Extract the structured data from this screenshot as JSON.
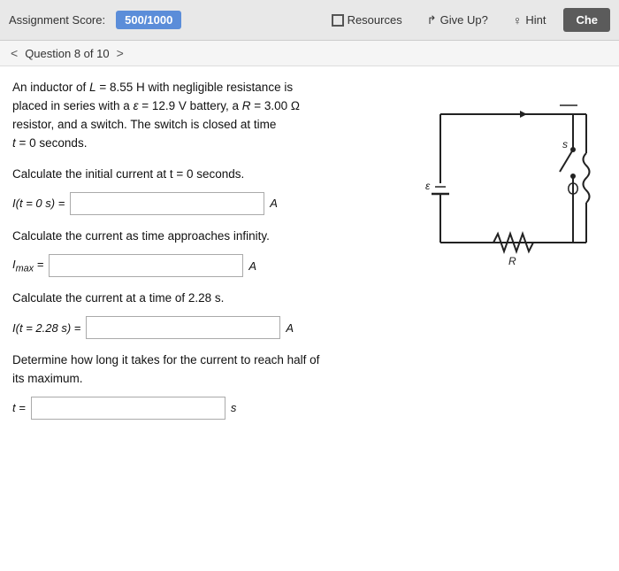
{
  "topbar": {
    "assignment_score_label": "Assignment Score:",
    "score_value": "500/1000",
    "resources_label": "Resources",
    "giveup_label": "Give Up?",
    "hint_label": "Hint",
    "check_label": "Che"
  },
  "question_nav": {
    "prev_label": "<",
    "text": "Question 8 of 10",
    "next_label": ">"
  },
  "problem": {
    "text_line1": "An inductor of L = 8.55 H with negligible resistance is",
    "text_line2": "placed in series with a ε = 12.9 V battery, a R = 3.00 Ω",
    "text_line3": "resistor, and a switch. The switch is closed at time",
    "text_line4": "t = 0 seconds.",
    "subq1": "Calculate the initial current at t = 0 seconds.",
    "answer1_label": "I(t = 0 s) =",
    "answer1_unit": "A",
    "subq2": "Calculate the current as time approaches infinity.",
    "answer2_label": "Iₘₐₓ =",
    "answer2_unit": "A",
    "subq3": "Calculate the current at a time of 2.28 s.",
    "answer3_label": "I(t = 2.28 s) =",
    "answer3_unit": "A",
    "subq4": "Determine how long it takes for the current to reach half of its maximum.",
    "answer4_label": "t =",
    "answer4_unit": "s"
  }
}
